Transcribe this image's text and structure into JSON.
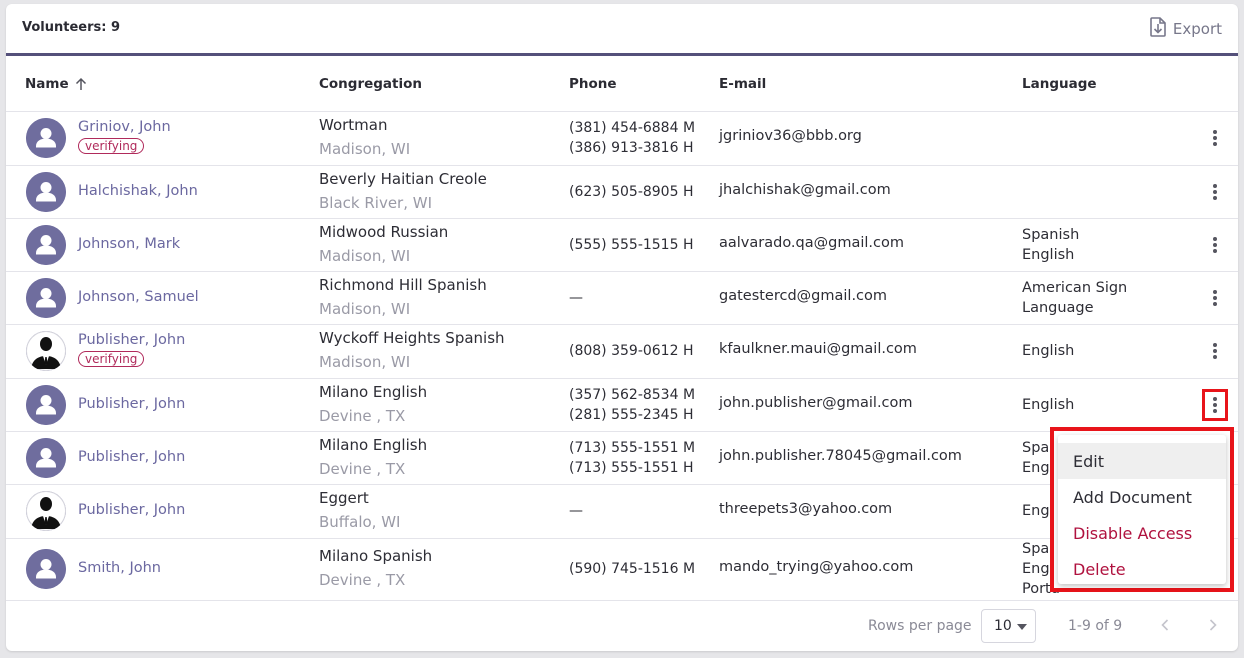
{
  "header": {
    "title": "Volunteers: 9",
    "export_label": "Export"
  },
  "columns": {
    "name": "Name",
    "congregation": "Congregation",
    "phone": "Phone",
    "email": "E-mail",
    "language": "Language"
  },
  "rows": [
    {
      "name": "Griniov, John",
      "badge": "verifying",
      "congregation": "Wortman",
      "location": "Madison, WI",
      "phones": [
        "(381) 454-6884 M",
        "(386) 913-3816 H"
      ],
      "email": "jgriniov36@bbb.org",
      "languages": [],
      "avatar": "default"
    },
    {
      "name": "Halchishak, John",
      "badge": "",
      "congregation": "Beverly Haitian Creole",
      "location": "Black River, WI",
      "phones": [
        "(623) 505-8905 H"
      ],
      "email": "jhalchishak@gmail.com",
      "languages": [],
      "avatar": "default"
    },
    {
      "name": "Johnson, Mark",
      "badge": "",
      "congregation": "Midwood Russian",
      "location": "Madison, WI",
      "phones": [
        "(555) 555-1515 H"
      ],
      "email": "aalvarado.qa@gmail.com",
      "languages": [
        "Spanish",
        "English"
      ],
      "avatar": "default"
    },
    {
      "name": "Johnson, Samuel",
      "badge": "",
      "congregation": "Richmond Hill Spanish",
      "location": "Madison, WI",
      "phones": [
        "—"
      ],
      "email": "gatestercd@gmail.com",
      "languages": [
        "American Sign",
        "Language"
      ],
      "avatar": "default"
    },
    {
      "name": "Publisher, John",
      "badge": "verifying",
      "congregation": "Wyckoff Heights Spanish",
      "location": "Madison, WI",
      "phones": [
        "(808) 359-0612 H"
      ],
      "email": "kfaulkner.maui@gmail.com",
      "languages": [
        "English"
      ],
      "avatar": "photo"
    },
    {
      "name": "Publisher, John",
      "badge": "",
      "congregation": "Milano English",
      "location": "Devine , TX",
      "phones": [
        "(357) 562-8534 M",
        "(281) 555-2345 H"
      ],
      "email": "john.publisher@gmail.com",
      "languages": [
        "English"
      ],
      "avatar": "default"
    },
    {
      "name": "Publisher, John",
      "badge": "",
      "congregation": "Milano English",
      "location": "Devine , TX",
      "phones": [
        "(713) 555-1551 M",
        "(713) 555-1551 H"
      ],
      "email": "john.publisher.78045@gmail.com",
      "languages": [
        "Span",
        "Engl"
      ],
      "avatar": "default"
    },
    {
      "name": "Publisher, John",
      "badge": "",
      "congregation": "Eggert",
      "location": "Buffalo, WI",
      "phones": [
        "—"
      ],
      "email": "threepets3@yahoo.com",
      "languages": [
        "Engl"
      ],
      "avatar": "photo"
    },
    {
      "name": "Smith, John",
      "badge": "",
      "congregation": "Milano Spanish",
      "location": "Devine , TX",
      "phones": [
        "(590) 745-1516 M"
      ],
      "email": "mando_trying@yahoo.com",
      "languages": [
        "Span",
        "Engl",
        "Portu"
      ],
      "avatar": "default"
    }
  ],
  "context_menu": {
    "items": [
      "Edit",
      "Add Document",
      "Disable Access",
      "Delete"
    ]
  },
  "pagination": {
    "rows_per_page_label": "Rows per page",
    "rows_per_page_value": "10",
    "range": "1-9 of 9"
  },
  "colors": {
    "accent": "#54507a",
    "link": "#6b68a0",
    "danger": "#b0123f",
    "badge": "#b02a5b",
    "highlight": "#e8141a"
  }
}
